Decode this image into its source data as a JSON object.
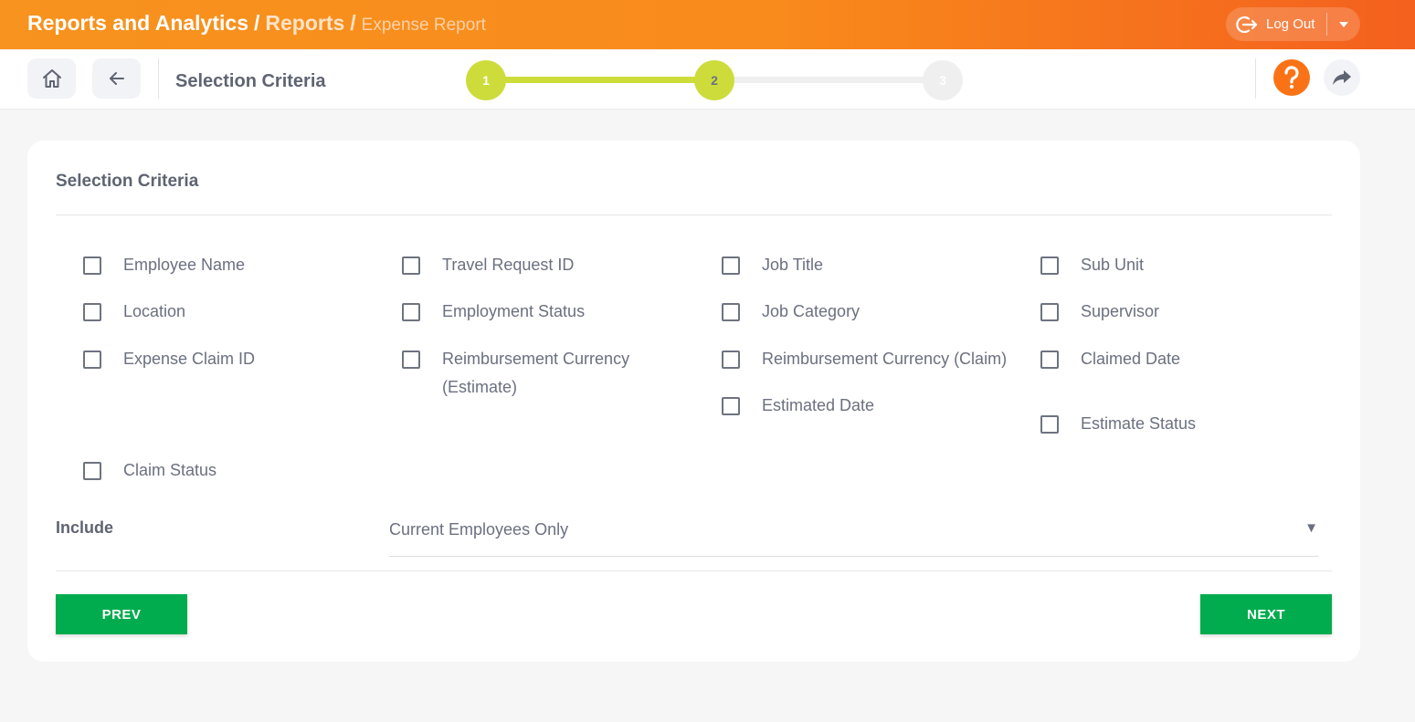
{
  "header": {
    "breadcrumbs": [
      "Reports and Analytics",
      "Reports",
      "Expense Report"
    ],
    "separator": "/",
    "logout_label": "Log Out",
    "colors": {
      "gradient_start": "#f7931e",
      "gradient_end": "#f4601e"
    }
  },
  "toolbar": {
    "title": "Selection Criteria",
    "home_icon": "home-icon",
    "back_icon": "arrow-left-icon",
    "help_icon": "question-icon",
    "share_icon": "share-icon",
    "steps": [
      {
        "label": "1",
        "state": "complete"
      },
      {
        "label": "2",
        "state": "current"
      },
      {
        "label": "3",
        "state": "pending"
      }
    ],
    "colors": {
      "step_active": "#cddc3b",
      "step_pending": "#efefef",
      "help": "#f97316"
    }
  },
  "card": {
    "title": "Selection Criteria",
    "options": [
      {
        "label": "Employee Name",
        "checked": false
      },
      {
        "label": "Travel Request ID",
        "checked": false
      },
      {
        "label": "Job Title",
        "checked": false
      },
      {
        "label": "Sub Unit",
        "checked": false
      },
      {
        "label": "Location",
        "checked": false
      },
      {
        "label": "Employment Status",
        "checked": false
      },
      {
        "label": "Job Category",
        "checked": false
      },
      {
        "label": "Supervisor",
        "checked": false
      },
      {
        "label": "Expense Claim ID",
        "checked": false
      },
      {
        "label": "Reimbursement Currency (Estimate)",
        "checked": false
      },
      {
        "label": "Reimbursement Currency (Claim)",
        "checked": false
      },
      {
        "label": "Claimed Date",
        "checked": false
      },
      {
        "label": "Estimated Date",
        "checked": false
      },
      {
        "label": "Estimate Status",
        "checked": false
      },
      {
        "label": "Claim Status",
        "checked": false
      }
    ],
    "include": {
      "label": "Include",
      "value": "Current Employees Only",
      "arrow": "▼"
    },
    "prev_label": "PREV",
    "next_label": "NEXT",
    "colors": {
      "button": "#00ac4e"
    }
  }
}
